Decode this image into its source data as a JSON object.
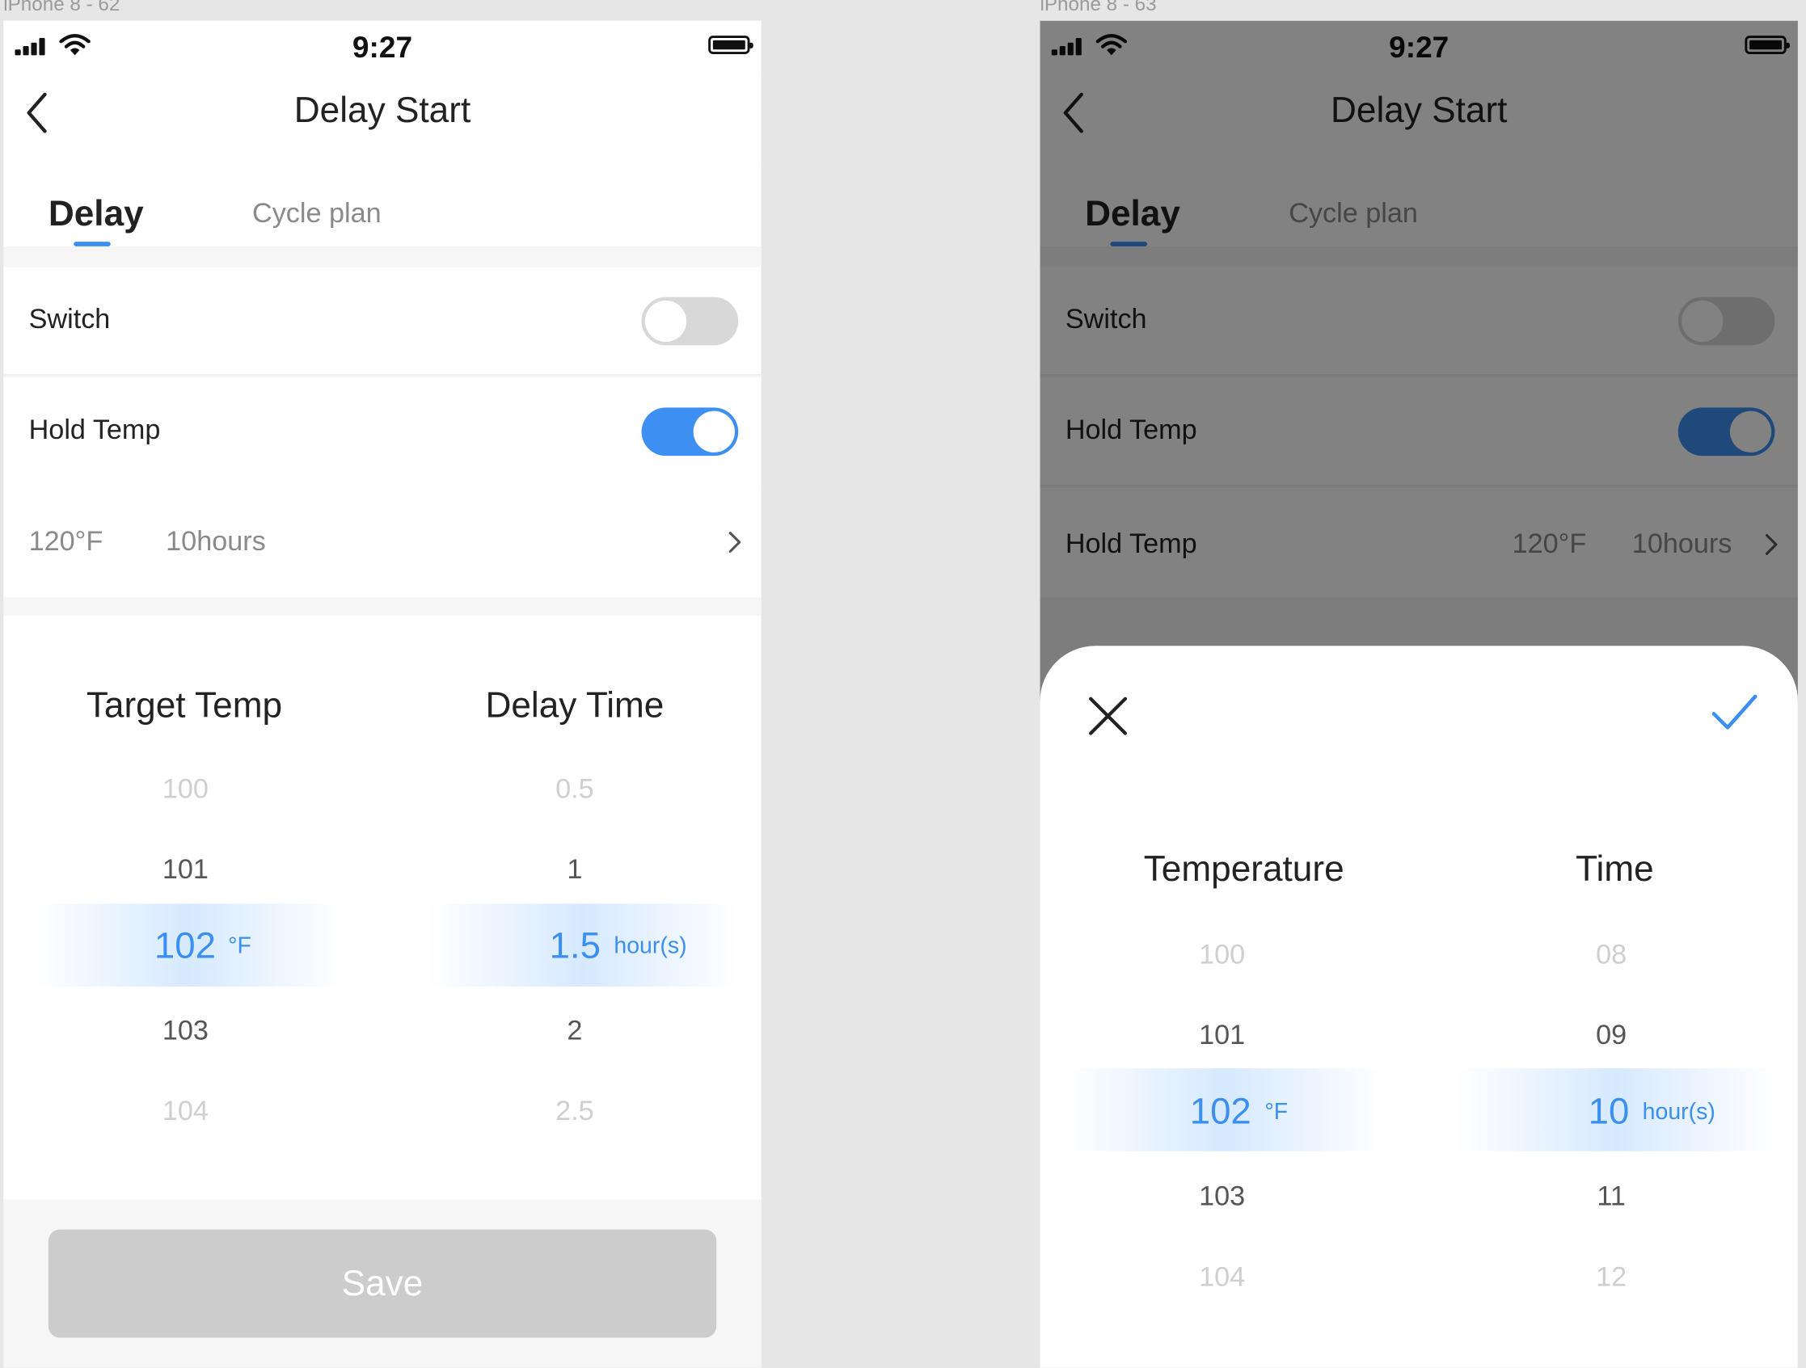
{
  "artboards": [
    {
      "label": "iPhone 8 - 62"
    },
    {
      "label": "iPhone 8 - 63"
    }
  ],
  "status_bar": {
    "time": "9:27"
  },
  "nav": {
    "title": "Delay Start"
  },
  "tabs": [
    {
      "label": "Delay",
      "active": true
    },
    {
      "label": "Cycle plan",
      "active": false
    }
  ],
  "screen1": {
    "switch_row": {
      "label": "Switch",
      "on": false
    },
    "hold_temp_row": {
      "label": "Hold Temp",
      "on": true
    },
    "summary": {
      "temp": "120°F",
      "time": "10hours"
    },
    "picker": {
      "temp_column": {
        "title": "Target Temp",
        "items": [
          "100",
          "101",
          "102",
          "103",
          "104"
        ],
        "selected": "102",
        "unit": "°F"
      },
      "time_column": {
        "title": "Delay Time",
        "items": [
          "0.5",
          "1",
          "1.5",
          "2",
          "2.5"
        ],
        "selected": "1.5",
        "unit": "hour(s)"
      }
    },
    "save_label": "Save"
  },
  "screen2": {
    "switch_row": {
      "label": "Switch",
      "on": false
    },
    "hold_temp_row": {
      "label": "Hold Temp",
      "on": true
    },
    "summary": {
      "label": "Hold Temp",
      "temp": "120°F",
      "time": "10hours"
    },
    "sheet": {
      "temp_column": {
        "title": "Temperature",
        "items": [
          "100",
          "101",
          "102",
          "103",
          "104"
        ],
        "selected": "102",
        "unit": "°F"
      },
      "time_column": {
        "title": "Time",
        "items": [
          "08",
          "09",
          "10",
          "11",
          "12"
        ],
        "selected": "10",
        "unit": "hour(s)"
      }
    }
  },
  "colors": {
    "accent": "#3b8ff0",
    "toggle_off": "#d8d8d8",
    "save_disabled": "#cccccc",
    "overlay": "rgba(0,0,0,0.49)"
  },
  "icons": [
    "signal-icon",
    "wifi-icon",
    "battery-icon",
    "back-icon",
    "chevron-right-icon",
    "close-icon",
    "check-icon"
  ]
}
